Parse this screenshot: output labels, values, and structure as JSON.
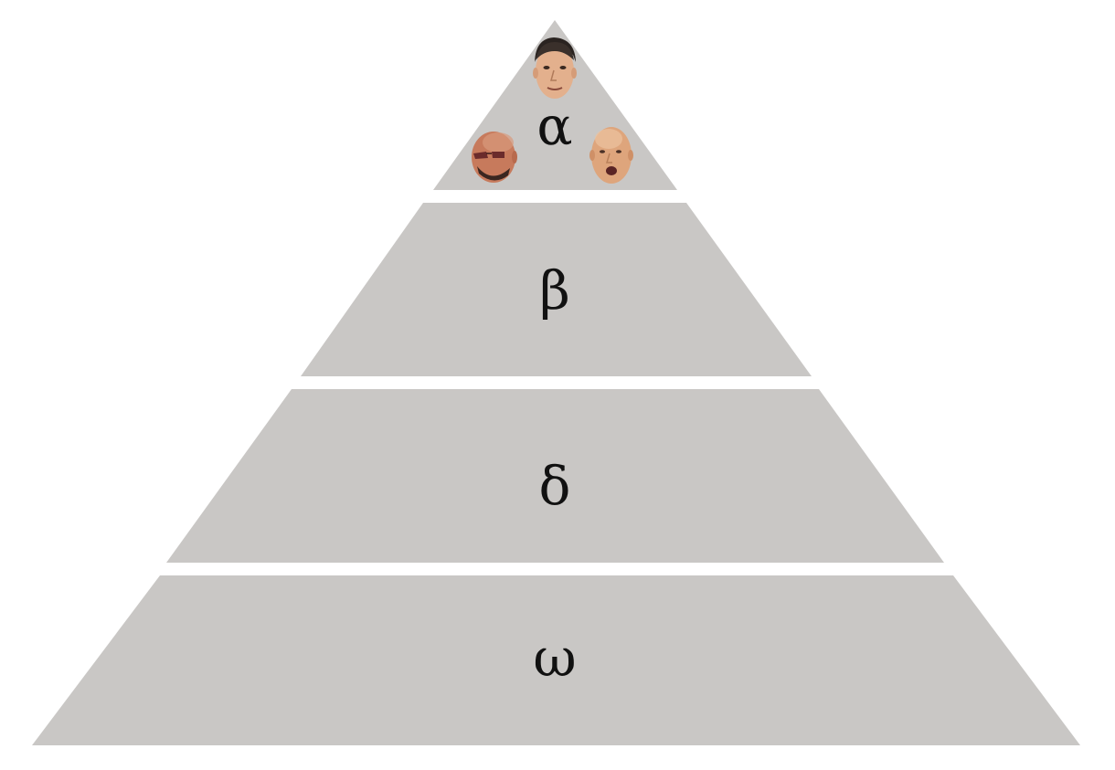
{
  "pyramid": {
    "fill_color": "#c9c7c5",
    "tiers": [
      {
        "label": "α"
      },
      {
        "label": "β"
      },
      {
        "label": "δ"
      },
      {
        "label": "ω"
      }
    ]
  },
  "faces": [
    {
      "icon": "bald-man-face-icon",
      "tier": "α",
      "skin": "#e3b08d",
      "hair": "#2a2320"
    },
    {
      "icon": "bald-man-sunglasses-face-icon",
      "tier": "α",
      "skin": "#c77a5c",
      "hair": "none"
    },
    {
      "icon": "bald-man-shouting-face-icon",
      "tier": "α",
      "skin": "#dea57c",
      "hair": "none"
    }
  ]
}
